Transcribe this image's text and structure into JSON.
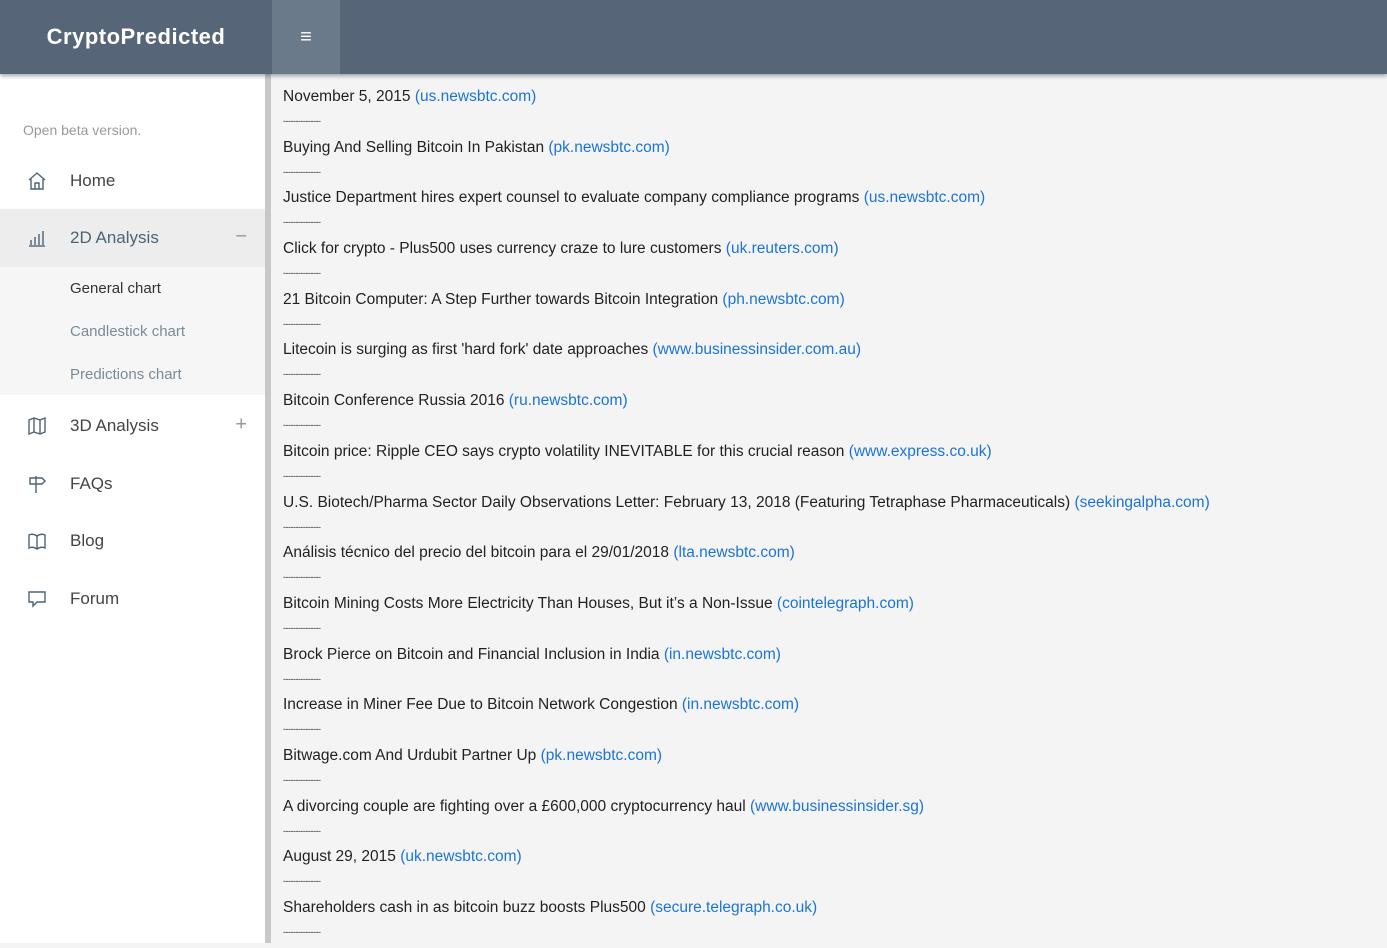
{
  "header": {
    "brand": "CryptoPredicted",
    "menu_icon": "≡"
  },
  "sidebar": {
    "beta_note": "Open beta version.",
    "items": [
      {
        "label": "Home",
        "icon": "home-icon"
      },
      {
        "label": "2D Analysis",
        "icon": "bar-chart-icon",
        "toggle": "−"
      },
      {
        "label": "3D Analysis",
        "icon": "map-icon",
        "toggle": "+"
      },
      {
        "label": "FAQs",
        "icon": "signpost-icon"
      },
      {
        "label": "Blog",
        "icon": "book-icon"
      },
      {
        "label": "Forum",
        "icon": "chat-icon"
      }
    ],
    "submenu": [
      {
        "label": "General chart"
      },
      {
        "label": "Candlestick chart"
      },
      {
        "label": "Predictions chart"
      }
    ]
  },
  "colors": {
    "topbar": "#566678",
    "link": "#1b74d6",
    "active_bg": "#ededed"
  },
  "news": {
    "separator": "---------------",
    "items": [
      {
        "title": "November 5, 2015",
        "source": "(us.newsbtc.com)"
      },
      {
        "title": "Buying And Selling Bitcoin In Pakistan",
        "source": "(pk.newsbtc.com)"
      },
      {
        "title": "Justice Department hires expert counsel to evaluate company compliance programs",
        "source": "(us.newsbtc.com)"
      },
      {
        "title": "Click for crypto - Plus500 uses currency craze to lure customers",
        "source": "(uk.reuters.com)"
      },
      {
        "title": "21 Bitcoin Computer: A Step Further towards Bitcoin Integration",
        "source": "(ph.newsbtc.com)"
      },
      {
        "title": "Litecoin is surging as first 'hard fork' date approaches",
        "source": "(www.businessinsider.com.au)"
      },
      {
        "title": "Bitcoin Conference Russia 2016",
        "source": "(ru.newsbtc.com)"
      },
      {
        "title": "Bitcoin price: Ripple CEO says crypto volatility INEVITABLE for this crucial reason",
        "source": "(www.express.co.uk)"
      },
      {
        "title": "U.S. Biotech/Pharma Sector Daily Observations Letter: February 13, 2018 (Featuring Tetraphase Pharmaceuticals)",
        "source": "(seekingalpha.com)"
      },
      {
        "title": "Análisis técnico del precio del bitcoin para el 29/01/2018",
        "source": "(lta.newsbtc.com)"
      },
      {
        "title": "Bitcoin Mining Costs More Electricity Than Houses, But it’s a Non-Issue",
        "source": "(cointelegraph.com)"
      },
      {
        "title": "Brock Pierce on Bitcoin and Financial Inclusion in India",
        "source": "(in.newsbtc.com)"
      },
      {
        "title": "Increase in Miner Fee Due to Bitcoin Network Congestion",
        "source": "(in.newsbtc.com)"
      },
      {
        "title": "Bitwage.com And Urdubit Partner Up",
        "source": "(pk.newsbtc.com)"
      },
      {
        "title": "A divorcing couple are fighting over a £600,000 cryptocurrency haul",
        "source": "(www.businessinsider.sg)"
      },
      {
        "title": "August 29, 2015",
        "source": "(uk.newsbtc.com)"
      },
      {
        "title": "Shareholders cash in as bitcoin buzz boosts Plus500",
        "source": "(secure.telegraph.co.uk)"
      }
    ]
  }
}
